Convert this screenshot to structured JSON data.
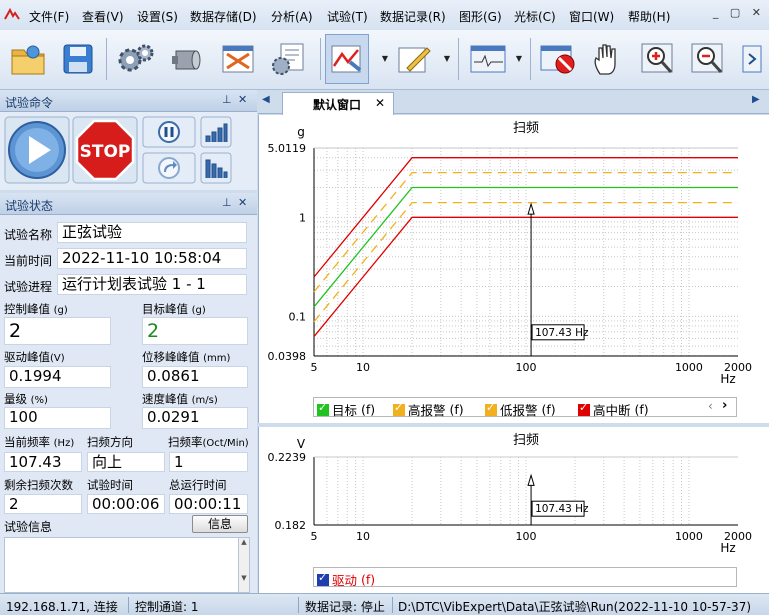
{
  "menu": {
    "items": [
      "文件(F)",
      "查看(V)",
      "设置(S)",
      "数据存储(D)",
      "分析(A)",
      "试验(T)",
      "数据记录(R)",
      "图形(G)",
      "光标(C)",
      "窗口(W)",
      "帮助(H)"
    ]
  },
  "toolbar": {
    "icons": [
      "open-folder-icon",
      "save-disk-icon",
      "settings-gears-icon",
      "cylinder-icon",
      "test-report-icon",
      "document-gear-icon",
      "run-test-icon",
      "pencil-edit-icon",
      "waveform-window-icon",
      "stop-display-icon",
      "hand-pan-icon",
      "zoom-in-icon",
      "zoom-out-icon",
      "next-icon"
    ]
  },
  "panes": {
    "command": {
      "title": "试验命令"
    },
    "status": {
      "title": "试验状态"
    }
  },
  "command": {
    "stop_label": "STOP"
  },
  "status": {
    "test_name_label": "试验名称",
    "test_name": "正弦试验",
    "current_time_label": "当前时间",
    "current_time": "2022-11-10 10:58:04",
    "progress_label": "试验进程",
    "progress": "运行计划表试验 1 - 1",
    "control_peak_label": "控制峰值",
    "control_peak_unit": "(g)",
    "control_peak": "2",
    "target_peak_label": "目标峰值",
    "target_peak_unit": "(g)",
    "target_peak": "2",
    "drive_peak_label": "驱动峰值",
    "drive_peak_unit": "(V)",
    "drive_peak": "0.1994",
    "disp_peak_label": "位移峰峰值",
    "disp_peak_unit": "(mm)",
    "disp_peak": "0.0861",
    "level_label": "量级",
    "level_unit": "(%)",
    "level": "100",
    "vel_peak_label": "速度峰值",
    "vel_peak_unit": "(m/s)",
    "vel_peak": "0.0291",
    "freq_label": "当前频率",
    "freq_unit": "(Hz)",
    "freq": "107.43",
    "sweep_dir_label": "扫频方向",
    "sweep_dir": "向上",
    "sweep_rate_label": "扫频率",
    "sweep_rate_unit": "(Oct/Min)",
    "sweep_rate": "1",
    "remaining_label": "剩余扫频次数",
    "remaining": "2",
    "test_time_label": "试验时间",
    "test_time": "00:00:06",
    "total_time_label": "总运行时间",
    "total_time": "00:00:11",
    "info_label": "试验信息",
    "info_button": "信息"
  },
  "tabs": {
    "default_window": "默认窗口"
  },
  "chart_data": [
    {
      "type": "line",
      "title": "扫频",
      "ylabel": "g",
      "xlabel": "Hz",
      "xscale": "log",
      "yscale": "log",
      "xlim": [
        5,
        2000
      ],
      "ylim": [
        0.0398,
        5.0119
      ],
      "x_ticks": [
        "5",
        "10",
        "100",
        "1000",
        "2000"
      ],
      "y_ticks": [
        "5.0119",
        "1",
        "0.1",
        "0.0398"
      ],
      "grid": true,
      "legend": "bottom",
      "cursor": {
        "x": 107.43,
        "label": "107.43 Hz"
      },
      "series": [
        {
          "name": "目标",
          "suffix": "(f)",
          "color": "#21c321",
          "style": "solid",
          "x": [
            5,
            20,
            2000
          ],
          "y": [
            0.125,
            2,
            2
          ]
        },
        {
          "name": "高报警",
          "suffix": "(f)",
          "color": "#f2b01e",
          "style": "dash",
          "x": [
            5,
            20,
            2000
          ],
          "y": [
            0.177,
            2.83,
            2.83
          ]
        },
        {
          "name": "低报警",
          "suffix": "(f)",
          "color": "#f2b01e",
          "style": "dash",
          "x": [
            5,
            20,
            2000
          ],
          "y": [
            0.0884,
            1.41,
            1.41
          ]
        },
        {
          "name": "高中断",
          "suffix": "(f)",
          "color": "#e00000",
          "style": "solid",
          "x": [
            5,
            20,
            2000
          ],
          "y": [
            0.25,
            4,
            4
          ]
        },
        {
          "name": "",
          "suffix": "",
          "color": "#e00000",
          "style": "solid",
          "x": [
            5,
            20,
            2000
          ],
          "y": [
            0.0625,
            1,
            1
          ]
        }
      ]
    },
    {
      "type": "line",
      "title": "扫频",
      "ylabel": "V",
      "xlabel": "Hz",
      "xscale": "log",
      "yscale": "linear",
      "xlim": [
        5,
        2000
      ],
      "ylim": [
        0.182,
        0.2239
      ],
      "x_ticks": [
        "5",
        "10",
        "100",
        "1000",
        "2000"
      ],
      "y_ticks": [
        "0.2239",
        "0.182"
      ],
      "grid": true,
      "legend": "bottom",
      "cursor": {
        "x": 107.43,
        "label": "107.43 Hz"
      },
      "series": [
        {
          "name": "驱动",
          "suffix": "(f)",
          "color": "#e00000",
          "style": "solid",
          "x": [],
          "y": []
        }
      ]
    }
  ],
  "statusbar": {
    "ip": "192.168.1.71, 连接",
    "channel": "控制通道: 1",
    "recording": "数据记录: 停止",
    "path": "D:\\DTC\\VibExpert\\Data\\正弦试验\\Run(2022-11-10 10-57-37)"
  }
}
